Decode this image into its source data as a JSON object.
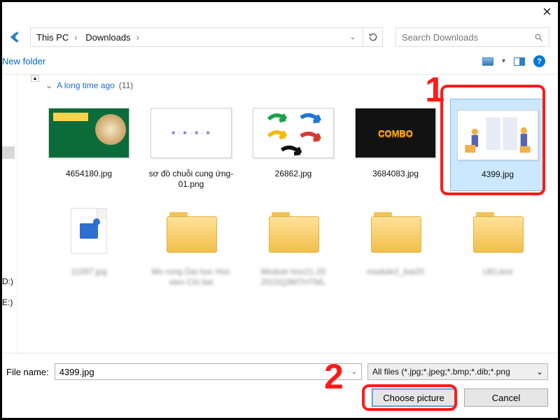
{
  "titlebar": {
    "close": "✕"
  },
  "address": {
    "crumbs": [
      "This PC",
      "Downloads"
    ],
    "chevron": "›"
  },
  "search": {
    "placeholder": "Search Downloads"
  },
  "toolbar": {
    "new_folder": "New folder"
  },
  "sidebar": {
    "drives": [
      "D:)",
      "E:)"
    ]
  },
  "group": {
    "chev": "⌄",
    "name": "A long time ago",
    "count": "(11)"
  },
  "items": [
    {
      "label": "4654180.jpg"
    },
    {
      "label": "sơ đồ chuỗi cung ứng-01.png"
    },
    {
      "label": "26862.jpg"
    },
    {
      "label": "3684083.jpg"
    },
    {
      "label": "4399.jpg"
    }
  ],
  "bottom": {
    "fn_label": "File name:",
    "fn_value": "4399.jpg",
    "filter": "All files (*.jpg;*.jpeg;*.bmp;*.dib;*.png",
    "filter_dd": "⌄",
    "choose": "Choose picture",
    "cancel": "Cancel"
  },
  "markers": {
    "one": "1",
    "two": "2"
  }
}
